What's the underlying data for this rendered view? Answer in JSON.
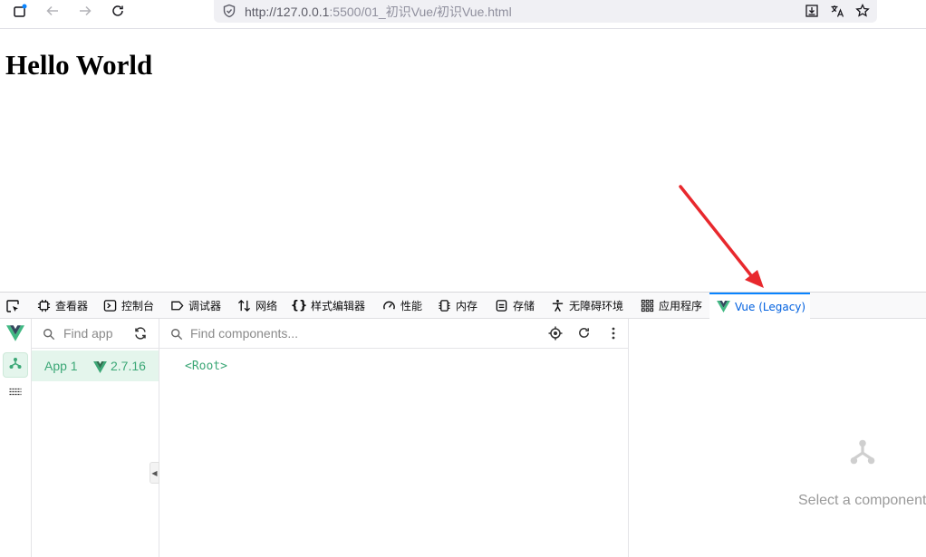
{
  "browser": {
    "url": {
      "host": "http://127.0.0.1",
      "rest": ":5500/01_初识Vue/初识Vue.html"
    },
    "icons": [
      "tab-manager-icon",
      "back-icon",
      "forward-icon",
      "reload-icon",
      "shield-icon",
      "download-icon",
      "translate-icon",
      "bookmark-star-icon"
    ]
  },
  "page": {
    "heading": "Hello World"
  },
  "devtools": {
    "tabs": [
      {
        "label": "",
        "icon": "pick-element-icon"
      },
      {
        "label": "查看器",
        "icon": "inspector-icon"
      },
      {
        "label": "控制台",
        "icon": "console-icon"
      },
      {
        "label": "调试器",
        "icon": "debugger-icon"
      },
      {
        "label": "网络",
        "icon": "network-icon"
      },
      {
        "label": "样式编辑器",
        "icon": "style-editor-icon"
      },
      {
        "label": "性能",
        "icon": "performance-icon"
      },
      {
        "label": "内存",
        "icon": "memory-icon"
      },
      {
        "label": "存储",
        "icon": "storage-icon"
      },
      {
        "label": "无障碍环境",
        "icon": "accessibility-icon"
      },
      {
        "label": "应用程序",
        "icon": "application-icon"
      },
      {
        "label": "Vue (Legacy)",
        "icon": "vue-logo-icon",
        "active": true
      }
    ]
  },
  "vue": {
    "find_app_placeholder": "Find app",
    "find_components_placeholder": "Find components...",
    "app": {
      "name": "App 1",
      "version": "2.7.16"
    },
    "root_node": "<Root>",
    "empty_state": "Select a component"
  },
  "colors": {
    "vue_green": "#3ba776",
    "annotation_red": "#e8282d",
    "active_tab_blue": "#0060df"
  }
}
